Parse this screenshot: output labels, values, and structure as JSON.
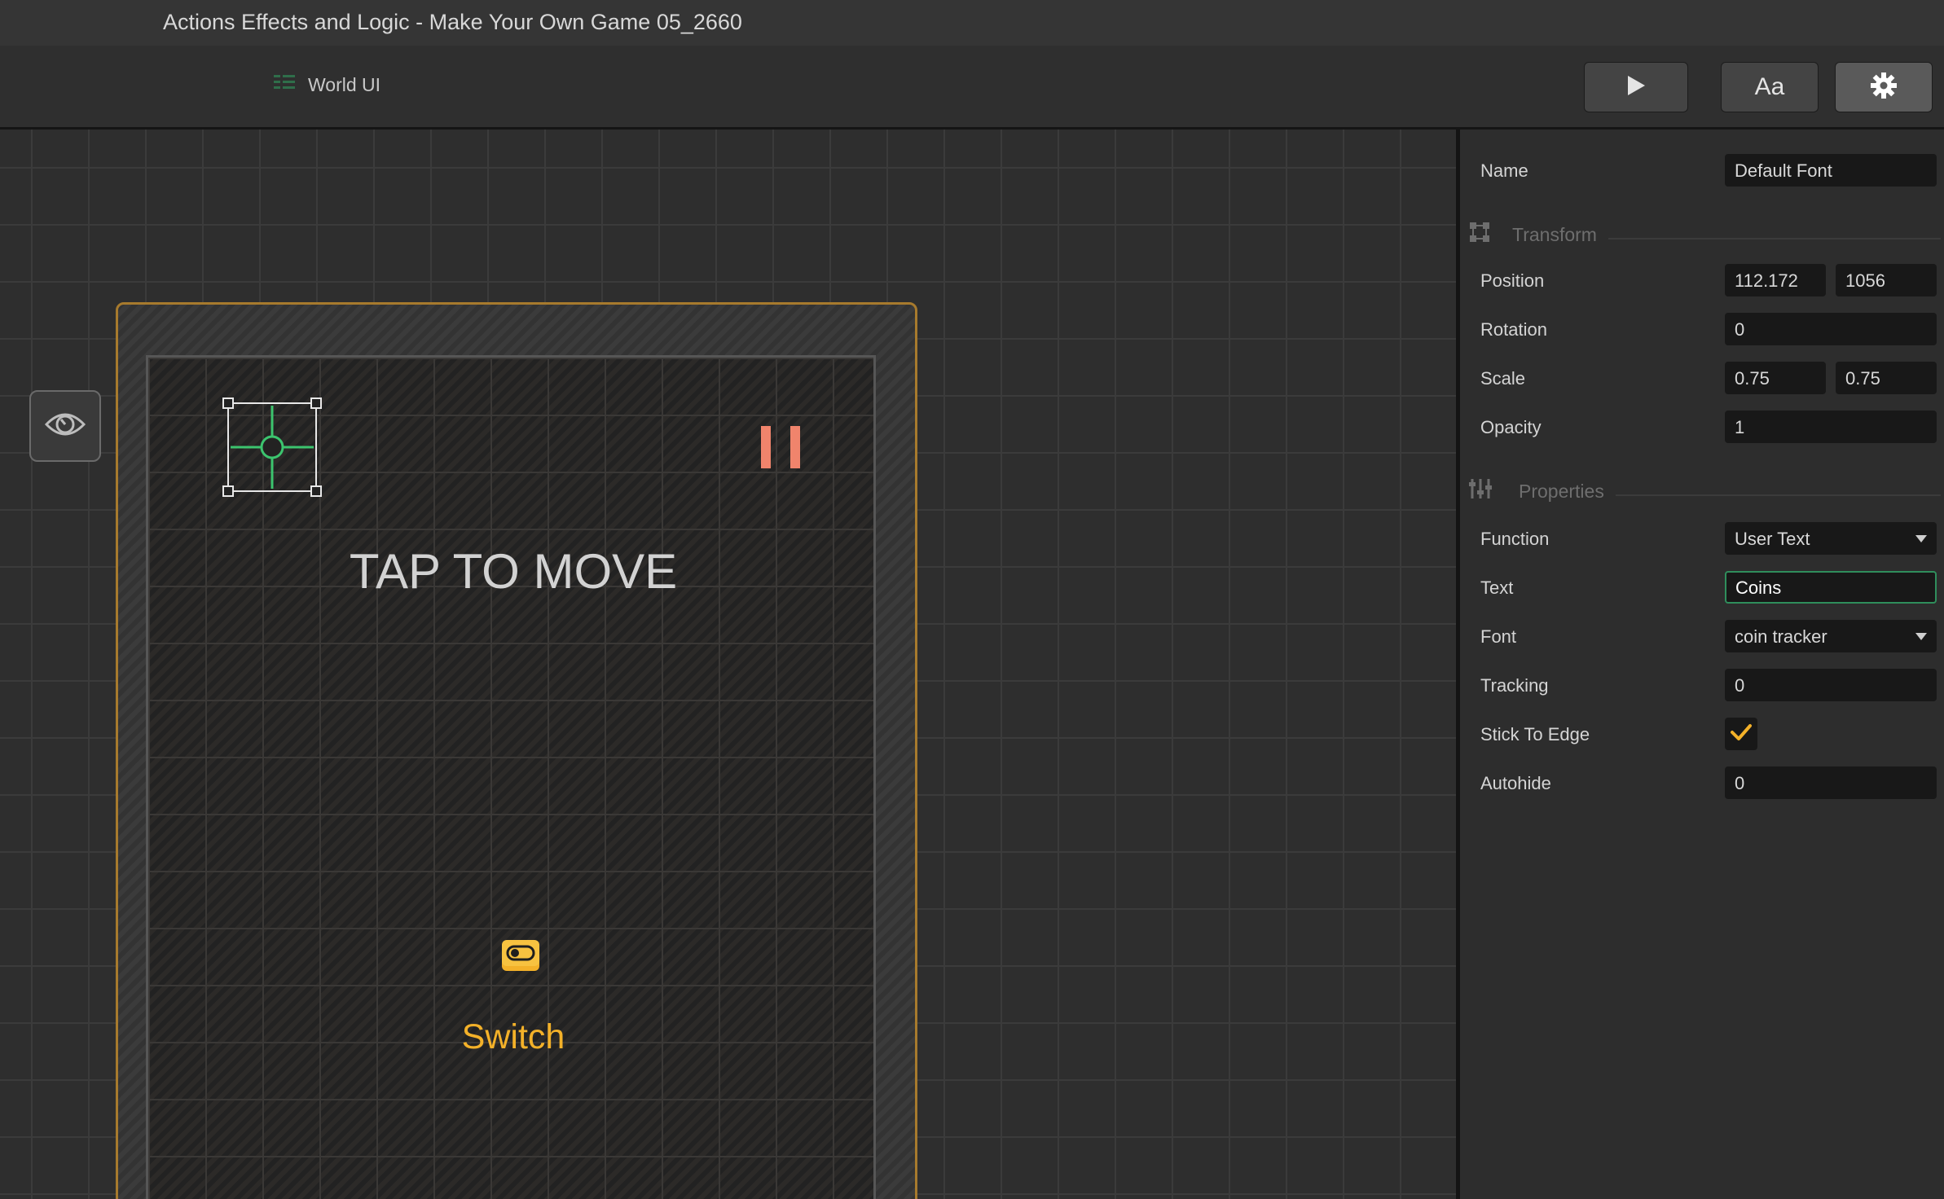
{
  "window": {
    "title": "Actions Effects and Logic - Make Your Own Game 05_2660"
  },
  "toolbar": {
    "breadcrumb_label": "World UI",
    "play_icon": "play-icon",
    "font_button_label": "Aa",
    "settings_icon": "gear-icon"
  },
  "canvas": {
    "tap_text": "TAP TO MOVE",
    "switch_label": "Switch",
    "pause_color": "#f0846c",
    "accent_color": "#f3b129",
    "frame_color": "#a77a2d"
  },
  "inspector": {
    "name_label": "Name",
    "name_value": "Default Font",
    "transform_header": "Transform",
    "position_label": "Position",
    "position_x": "112.172",
    "position_y": "1056",
    "rotation_label": "Rotation",
    "rotation_value": "0",
    "scale_label": "Scale",
    "scale_x": "0.75",
    "scale_y": "0.75",
    "opacity_label": "Opacity",
    "opacity_value": "1",
    "properties_header": "Properties",
    "function_label": "Function",
    "function_value": "User Text",
    "text_label": "Text",
    "text_value": "Coins",
    "font_label": "Font",
    "font_value": "coin tracker",
    "tracking_label": "Tracking",
    "tracking_value": "0",
    "stick_label": "Stick To Edge",
    "stick_checked": true,
    "autohide_label": "Autohide",
    "autohide_value": "0"
  }
}
